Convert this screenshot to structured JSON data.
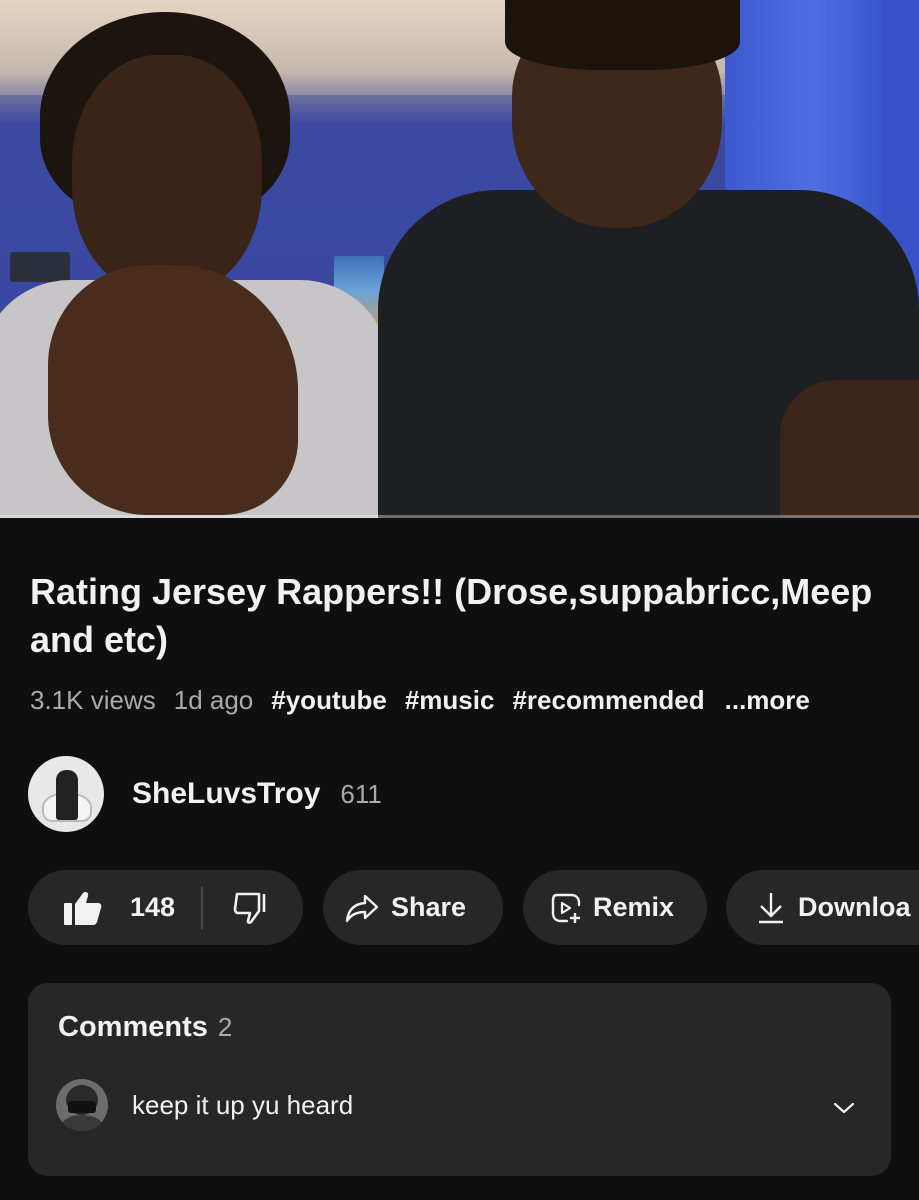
{
  "video": {
    "progress_fraction": 0.0
  },
  "title": "Rating Jersey Rappers!! (Drose,suppabricc,Meep and etc)",
  "meta": {
    "views": "3.1K views",
    "age": "1d ago",
    "hashtags": [
      "#youtube",
      "#music",
      "#recommended"
    ],
    "more": "...more"
  },
  "channel": {
    "name": "SheLuvsTroy",
    "subscribers": "611"
  },
  "actions": {
    "like_count": "148",
    "share_label": "Share",
    "remix_label": "Remix",
    "download_label": "Downloa"
  },
  "comments": {
    "title": "Comments",
    "count": "2",
    "top_comment": "keep it up yu heard"
  },
  "colors": {
    "background": "#0f0f0f",
    "pill": "#272727",
    "text_primary": "#f1f1f1",
    "text_secondary": "#aaaaaa",
    "progress": "#ff0000"
  },
  "icons": [
    "thumbs-up-icon",
    "thumbs-down-icon",
    "share-arrow-icon",
    "remix-icon",
    "download-icon",
    "chevron-down-icon"
  ]
}
